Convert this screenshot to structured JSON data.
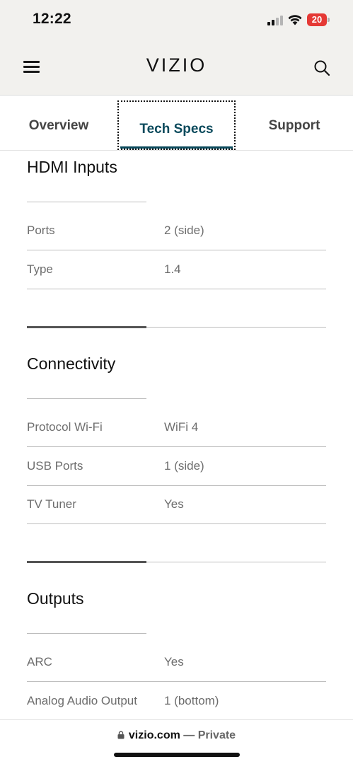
{
  "status_bar": {
    "time": "12:22",
    "battery_level": "20",
    "battery_color": "#e53935"
  },
  "header": {
    "logo": "VIZIO",
    "menu_icon": "hamburger-menu-icon",
    "search_icon": "search-icon"
  },
  "tabs": [
    {
      "label": "Overview",
      "active": false
    },
    {
      "label": "Tech Specs",
      "active": true
    },
    {
      "label": "Support",
      "active": false
    }
  ],
  "sections": [
    {
      "title": "HDMI Inputs",
      "rows": [
        {
          "label": "Ports",
          "value": "2 (side)"
        },
        {
          "label": "Type",
          "value": "1.4"
        }
      ]
    },
    {
      "title": "Connectivity",
      "rows": [
        {
          "label": "Protocol Wi-Fi",
          "value": "WiFi 4"
        },
        {
          "label": "USB Ports",
          "value": "1 (side)"
        },
        {
          "label": "TV Tuner",
          "value": "Yes"
        }
      ]
    },
    {
      "title": "Outputs",
      "rows": [
        {
          "label": "ARC",
          "value": "Yes"
        },
        {
          "label": "Analog Audio Output",
          "value": "1 (bottom)"
        }
      ]
    }
  ],
  "browser_bar": {
    "domain": "vizio.com",
    "separator": " — ",
    "mode": "Private"
  },
  "colors": {
    "accent": "#0b4a5c",
    "header_bg": "#f2f1ee"
  }
}
